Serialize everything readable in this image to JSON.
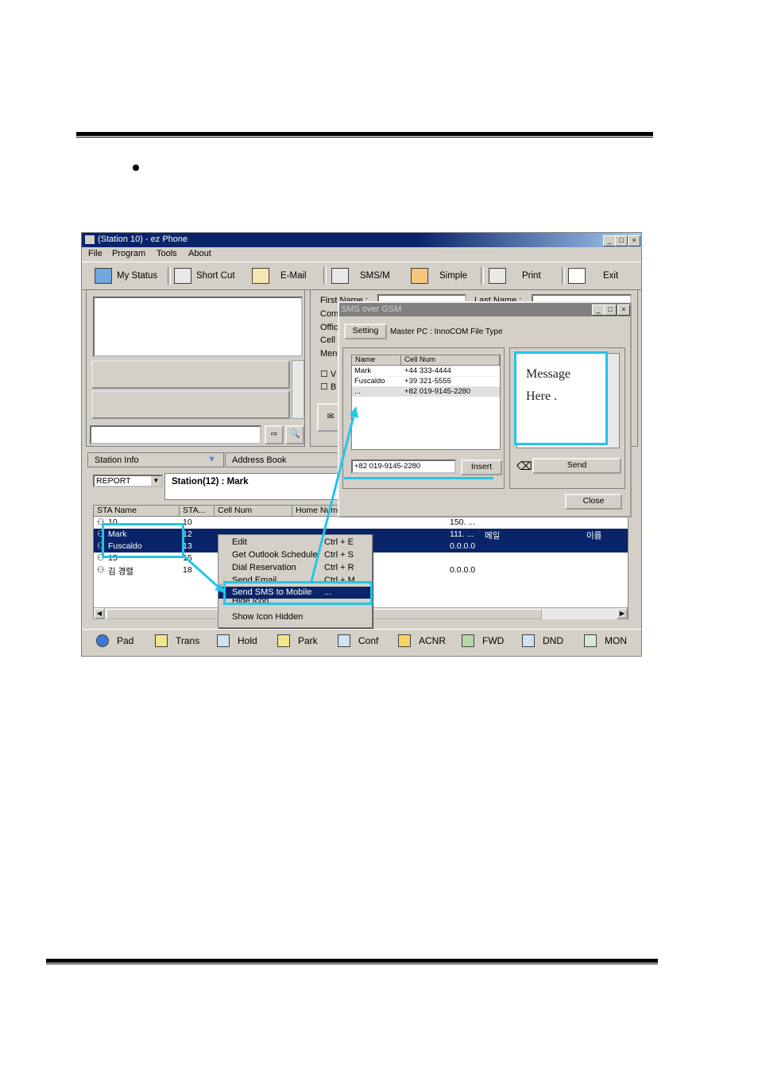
{
  "window": {
    "title": "(Station 10) - ez Phone",
    "menu": [
      "File",
      "Program",
      "Tools",
      "About"
    ],
    "toolbar": [
      "My Status",
      "Short Cut",
      "E-Mail",
      "SMS/M",
      "Simple",
      "Print",
      "Exit"
    ],
    "title_buttons": [
      "_",
      "□",
      "×"
    ]
  },
  "form_labels": [
    "First Name :",
    "Last Name :",
    "Com",
    "Offic",
    "Cell",
    "Men",
    "V",
    "B"
  ],
  "tabs": {
    "station_info": "Station Info",
    "address_book": "Address Book"
  },
  "report": {
    "selected": "REPORT",
    "station_label": "Station(12) :  Mark"
  },
  "station_table": {
    "columns": [
      "STA Name",
      "STA...",
      "Cell Num",
      "Home Num"
    ],
    "rows": [
      {
        "name": "10",
        "sta": "10",
        "ip": "150. ...",
        "extra": "",
        "extra2": ""
      },
      {
        "name": "Mark",
        "sta": "12",
        "ip": "111. ...",
        "extra": "메일",
        "extra2": "이름"
      },
      {
        "name": "Fuscaldo",
        "sta": "13",
        "ip": "0.0.0.0",
        "extra": "",
        "extra2": ""
      },
      {
        "name": "15",
        "sta": "15",
        "ip": "",
        "extra": "",
        "extra2": ""
      },
      {
        "name": "김 경렬",
        "sta": "18",
        "ip": "0.0.0.0",
        "extra": "",
        "extra2": ""
      }
    ]
  },
  "context_menu": [
    {
      "label": "Edit",
      "shortcut": "Ctrl + E"
    },
    {
      "label": "Get Outlook Schedule",
      "shortcut": "Ctrl + S"
    },
    {
      "label": "Dial Reservation",
      "shortcut": "Ctrl + R"
    },
    {
      "label": "Send Email",
      "shortcut": "Ctrl + M"
    },
    {
      "label": "Send SMS to Mobile",
      "shortcut": "..."
    },
    {
      "label": "Hide Icon",
      "shortcut": ""
    },
    {
      "label": "Show Icon Hidden",
      "shortcut": ""
    }
  ],
  "sms_dialog": {
    "title": "SMS over GSM",
    "setting_button": "Setting",
    "master_pc": "Master PC : InnoCOM File Type",
    "columns": [
      "Name",
      "Cell Num"
    ],
    "contacts": [
      {
        "name": "Mark",
        "cell": "+44 333-4444"
      },
      {
        "name": "Fuscaldo",
        "cell": "+39 321-5555"
      },
      {
        "name": "...",
        "cell": "+82 019-9145-2280"
      }
    ],
    "number_input": "+82 019-9145-2280",
    "insert_button": "Insert",
    "message_line1": "Message",
    "message_line2": "Here    .",
    "send_button": "Send",
    "close_button": "Close"
  },
  "status_bar": [
    "Pad",
    "Trans",
    "Hold",
    "Park",
    "Conf",
    "ACNR",
    "FWD",
    "DND",
    "MON"
  ],
  "colors": {
    "highlight": "#0a246a",
    "annotation": "#22c5e8",
    "face": "#d4d0c8"
  }
}
